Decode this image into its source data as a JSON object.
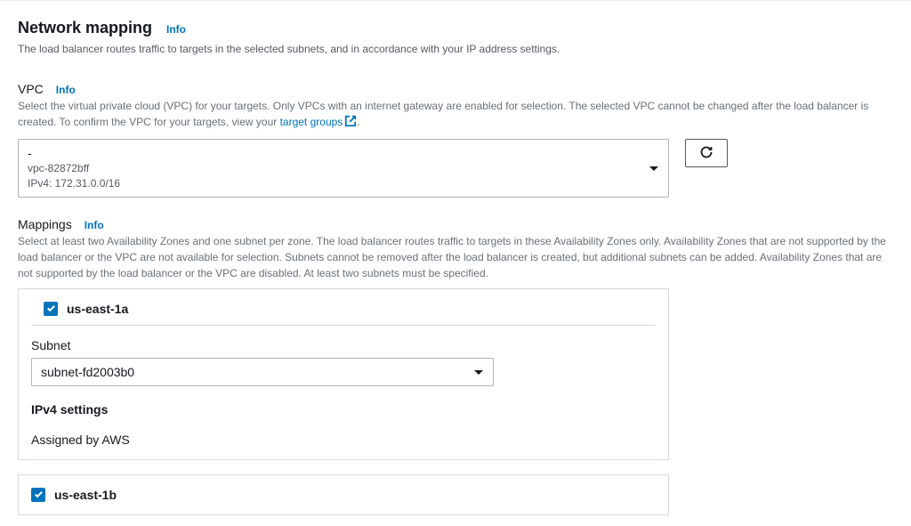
{
  "header": {
    "title": "Network mapping",
    "info": "Info",
    "desc": "The load balancer routes traffic to targets in the selected subnets, and in accordance with your IP address settings."
  },
  "vpc": {
    "label": "VPC",
    "info": "Info",
    "desc_pre": "Select the virtual private cloud (VPC) for your targets. Only VPCs with an internet gateway are enabled for selection. The selected VPC cannot be changed after the load balancer is created. To confirm the VPC for your targets, view your ",
    "link_text": "target groups",
    "desc_post": ".",
    "selected_name": "-",
    "selected_id": "vpc-82872bff",
    "selected_cidr": "IPv4: 172.31.0.0/16"
  },
  "mappings": {
    "label": "Mappings",
    "info": "Info",
    "desc": "Select at least two Availability Zones and one subnet per zone. The load balancer routes traffic to targets in these Availability Zones only. Availability Zones that are not supported by the load balancer or the VPC are not available for selection. Subnets cannot be removed after the load balancer is created, but additional subnets can be added. Availability Zones that are not supported by the load balancer or the VPC are disabled. At least two subnets must be specified.",
    "zones": [
      {
        "name": "us-east-1a",
        "checked": true,
        "subnet_label": "Subnet",
        "subnet_value": "subnet-fd2003b0",
        "ipv4_label": "IPv4 settings",
        "ipv4_value": "Assigned by AWS"
      },
      {
        "name": "us-east-1b",
        "checked": true
      }
    ]
  }
}
